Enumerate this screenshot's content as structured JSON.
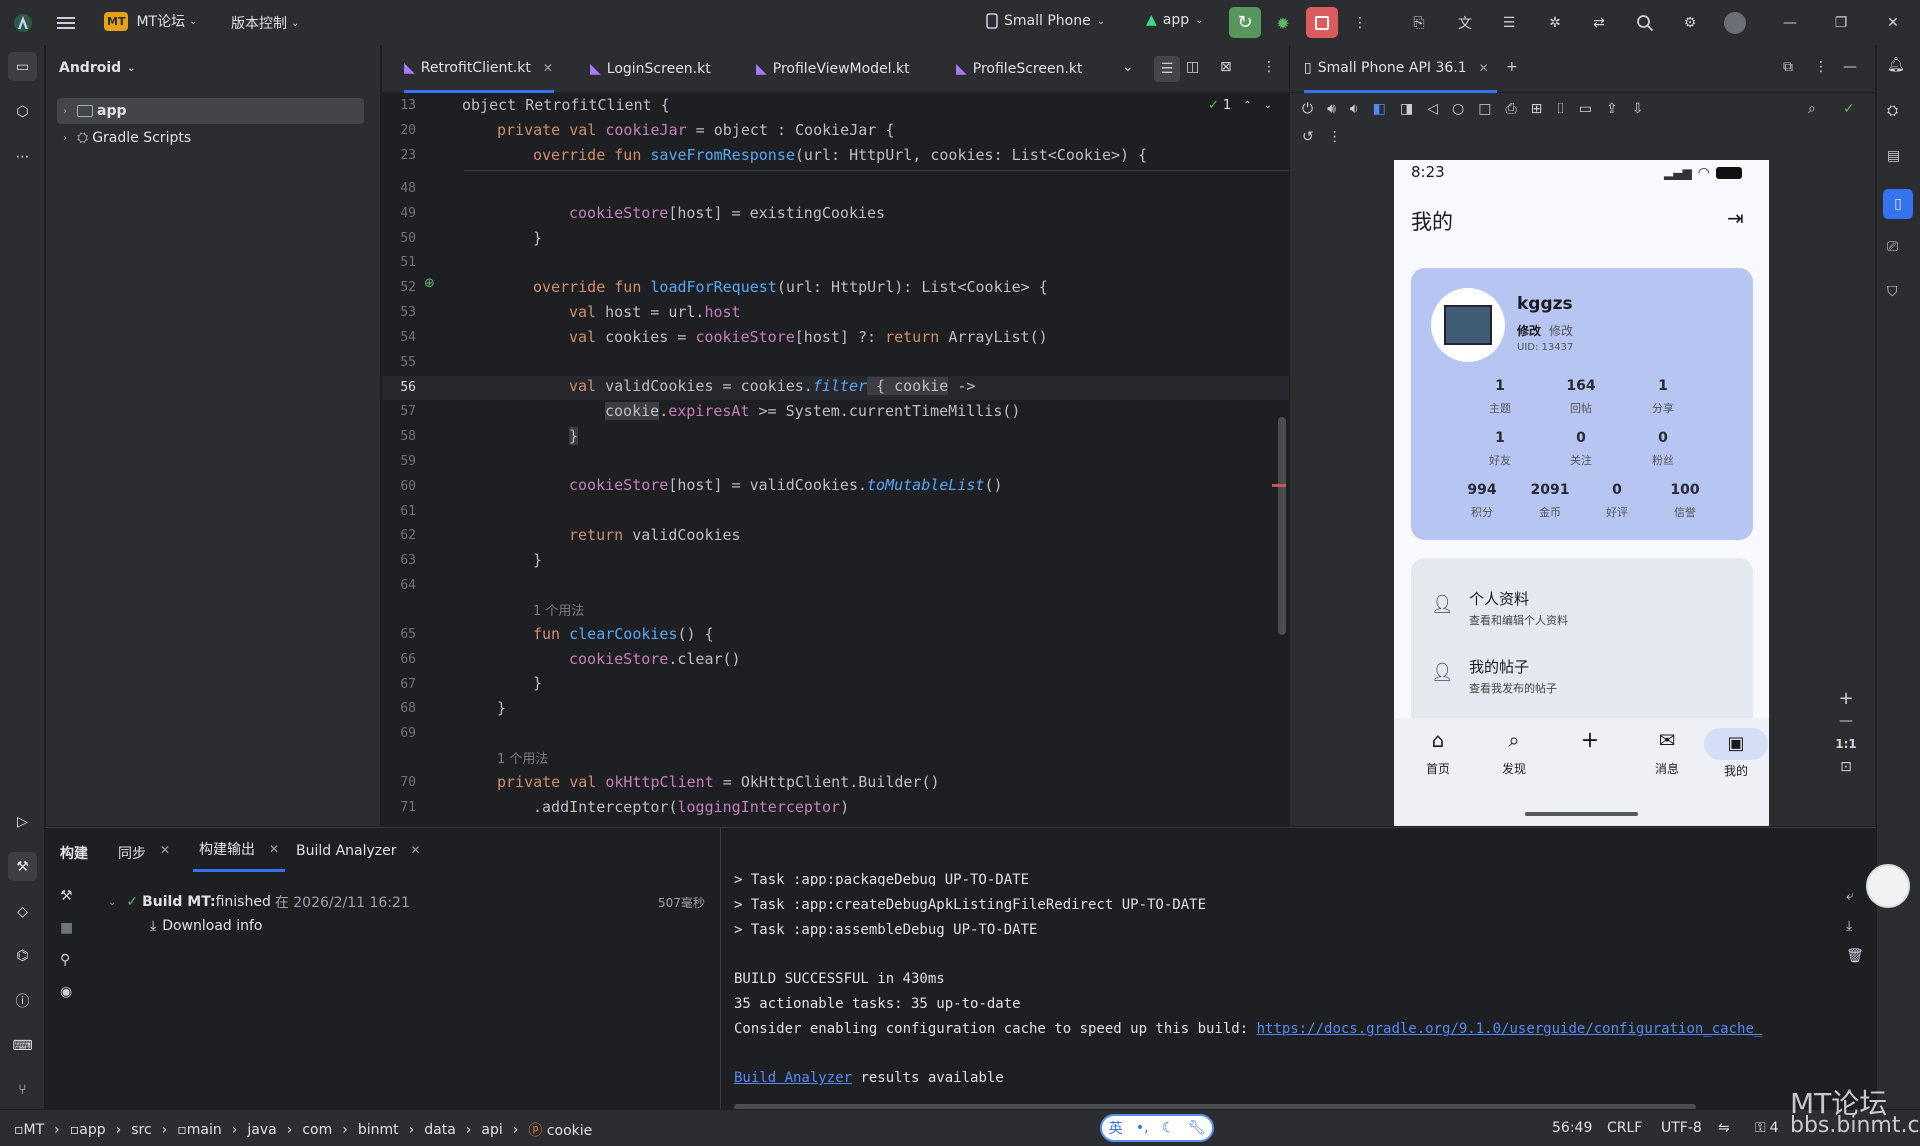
{
  "titlebar": {
    "project_badge": "MT",
    "project_name": "MT论坛",
    "vcs": "版本控制",
    "device": "Small Phone",
    "run_config": "app"
  },
  "project_panel": {
    "view_mode": "Android",
    "tree": [
      {
        "label": "app",
        "selected": true
      },
      {
        "label": "Gradle Scripts",
        "selected": false
      }
    ]
  },
  "editor": {
    "tabs": [
      {
        "label": "RetrofitClient.kt",
        "active": true
      },
      {
        "label": "LoginScreen.kt"
      },
      {
        "label": "ProfileViewModel.kt"
      },
      {
        "label": "ProfileScreen.kt"
      }
    ],
    "inspection_count": "1",
    "hint_usage_1": "1 个用法",
    "hint_usage_2": "1 个用法",
    "line_numbers": [
      "13",
      "20",
      "23",
      "48",
      "49",
      "50",
      "51",
      "52",
      "53",
      "54",
      "55",
      "56",
      "57",
      "58",
      "59",
      "60",
      "61",
      "62",
      "63",
      "64",
      "65",
      "66",
      "67",
      "68",
      "69",
      "70",
      "71"
    ],
    "sticky": {
      "l13": "object RetrofitClient {",
      "l20a": "private val ",
      "l20b": "cookieJar",
      "l20c": " = object : CookieJar {",
      "l23a": "override fun ",
      "l23b": "saveFromResponse",
      "l23c": "(url: HttpUrl, cookies: List<Cookie>) {"
    },
    "code": {
      "l49a": "cookieStore",
      "l49b": "[host] = existingCookies",
      "l50": "}",
      "l52a": "override fun ",
      "l52b": "loadForRequest",
      "l52c": "(url: HttpUrl): List<Cookie> {",
      "l53a": "val ",
      "l53b": "host = url.",
      "l53c": "host",
      "l54a": "val ",
      "l54b": "cookies = ",
      "l54c": "cookieStore",
      "l54d": "[host] ?: ",
      "l54e": "return ",
      "l54f": "ArrayList()",
      "l56a": "val ",
      "l56b": "validCookies = cookies.",
      "l56c": "filter",
      "l56d": " { ",
      "l56e": "cookie",
      "l56f": " ->",
      "l57a": "cookie",
      "l57b": ".",
      "l57c": "expiresAt",
      "l57d": " >= System.currentTimeMillis()",
      "l58": "}",
      "l60a": "cookieStore",
      "l60b": "[host] = validCookies.",
      "l60c": "toMutableList",
      "l60d": "()",
      "l62a": "return ",
      "l62b": "validCookies",
      "l63": "}",
      "l65a": "fun ",
      "l65b": "clearCookies",
      "l65c": "() {",
      "l66a": "cookieStore",
      "l66b": ".clear()",
      "l67": "}",
      "l68": "}",
      "l70a": "private val ",
      "l70b": "okHttpClient",
      "l70c": " = OkHttpClient.Builder()",
      "l71a": ".addInterceptor(",
      "l71b": "loggingInterceptor",
      "l71c": ")"
    }
  },
  "emulator": {
    "tab_label": "Small Phone API 36.1",
    "zoom_label": "1:1",
    "phone": {
      "time": "8:23",
      "page_title": "我的",
      "username": "kggzs",
      "edit_bold": "修改",
      "edit_light": "修改",
      "uid": "UID: 13437",
      "stats_row1": [
        {
          "value": "1",
          "label": "主题"
        },
        {
          "value": "164",
          "label": "回帖"
        },
        {
          "value": "1",
          "label": "分享"
        }
      ],
      "stats_row2": [
        {
          "value": "1",
          "label": "好友"
        },
        {
          "value": "0",
          "label": "关注"
        },
        {
          "value": "0",
          "label": "粉丝"
        }
      ],
      "stats_row3": [
        {
          "value": "994",
          "label": "积分"
        },
        {
          "value": "2091",
          "label": "金币"
        },
        {
          "value": "0",
          "label": "好评"
        },
        {
          "value": "100",
          "label": "信誉"
        }
      ],
      "menu": [
        {
          "title": "个人资料",
          "subtitle": "查看和编辑个人资料"
        },
        {
          "title": "我的帖子",
          "subtitle": "查看我发布的帖子"
        }
      ],
      "nav": [
        {
          "label": "首页",
          "icon": "home-icon"
        },
        {
          "label": "发现",
          "icon": "search-icon"
        },
        {
          "label": "",
          "icon": "plus-icon"
        },
        {
          "label": "消息",
          "icon": "mail-icon"
        },
        {
          "label": "我的",
          "icon": "person-icon"
        }
      ]
    }
  },
  "build": {
    "tabs": [
      {
        "label": "构建"
      },
      {
        "label": "同步"
      },
      {
        "label": "构建输出"
      },
      {
        "label": "Build Analyzer"
      }
    ],
    "tree": {
      "title_bold": "Build MT:",
      "title_rest": " finished",
      "time": "在 2026/2/11 16:21",
      "duration": "507毫秒",
      "child": "Download info"
    },
    "output": {
      "line1": "> Task :app:packageDebug UP-TO-DATE",
      "line2": "> Task :app:createDebugApkListingFileRedirect UP-TO-DATE",
      "line3": "> Task :app:assembleDebug UP-TO-DATE",
      "line4": "BUILD SUCCESSFUL in 430ms",
      "line5": "35 actionable tasks: 35 up-to-date",
      "line6": "Consider enabling configuration cache to speed up this build: ",
      "line6_link": "https://docs.gradle.org/9.1.0/userguide/configuration_cache_",
      "line7_link": "Build Analyzer",
      "line7_rest": " results available"
    }
  },
  "statusbar": {
    "breadcrumbs": [
      "MT",
      "app",
      "src",
      "main",
      "java",
      "com",
      "binmt",
      "data",
      "api",
      "cookie"
    ],
    "ime": "英",
    "position": "56:49",
    "line_sep": "CRLF",
    "encoding": "UTF-8",
    "indent": "4",
    "watermark": "MT论坛",
    "watermark_url": "bbs.binmt.cc"
  }
}
